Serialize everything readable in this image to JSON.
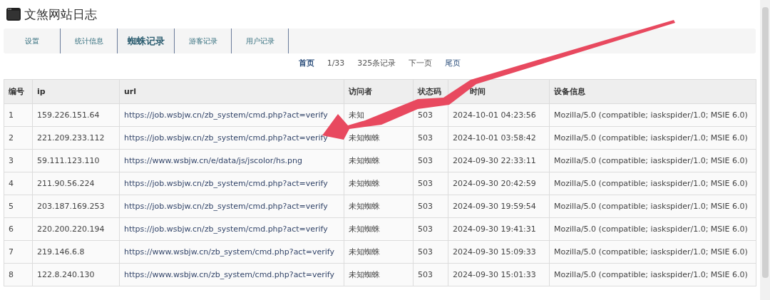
{
  "title": "文煞网站日志",
  "tabs": [
    {
      "label": "设置",
      "selected": false
    },
    {
      "label": "统计信息",
      "selected": false
    },
    {
      "label": "蜘蛛记录",
      "selected": true
    },
    {
      "label": "游客记录",
      "selected": false
    },
    {
      "label": "用户记录",
      "selected": false
    }
  ],
  "pager": [
    {
      "text": "首页",
      "kind": "link"
    },
    {
      "text": "1/33",
      "kind": "text"
    },
    {
      "text": "325条记录",
      "kind": "text"
    },
    {
      "text": "下一页",
      "kind": "text"
    },
    {
      "text": "尾页",
      "kind": "link"
    }
  ],
  "table": {
    "columns": [
      "编号",
      "ip",
      "url",
      "访问者",
      "状态码",
      "时间",
      "设备信息"
    ],
    "rows": [
      [
        "1",
        "159.226.151.64",
        "https://job.wsbjw.cn/zb_system/cmd.php?act=verify",
        "未知",
        "503",
        "2024-10-01 04:23:56",
        "Mozilla/5.0 (compatible; iaskspider/1.0; MSIE 6.0)"
      ],
      [
        "2",
        "221.209.233.112",
        "https://job.wsbjw.cn/zb_system/cmd.php?act=verify",
        "未知蜘蛛",
        "503",
        "2024-10-01 03:58:42",
        "Mozilla/5.0 (compatible; iaskspider/1.0; MSIE 6.0)"
      ],
      [
        "3",
        "59.111.123.110",
        "https://www.wsbjw.cn/e/data/js/jscolor/hs.png",
        "未知蜘蛛",
        "503",
        "2024-09-30 22:33:11",
        "Mozilla/5.0 (compatible; iaskspider/1.0; MSIE 6.0)"
      ],
      [
        "4",
        "211.90.56.224",
        "https://job.wsbjw.cn/zb_system/cmd.php?act=verify",
        "未知蜘蛛",
        "503",
        "2024-09-30 20:42:59",
        "Mozilla/5.0 (compatible; iaskspider/1.0; MSIE 6.0)"
      ],
      [
        "5",
        "203.187.169.253",
        "https://job.wsbjw.cn/zb_system/cmd.php?act=verify",
        "未知蜘蛛",
        "503",
        "2024-09-30 19:59:54",
        "Mozilla/5.0 (compatible; iaskspider/1.0; MSIE 6.0)"
      ],
      [
        "6",
        "220.200.220.194",
        "https://job.wsbjw.cn/zb_system/cmd.php?act=verify",
        "未知蜘蛛",
        "503",
        "2024-09-30 19:41:31",
        "Mozilla/5.0 (compatible; iaskspider/1.0; MSIE 6.0)"
      ],
      [
        "7",
        "219.146.6.8",
        "https://www.wsbjw.cn/zb_system/cmd.php?act=verify",
        "未知蜘蛛",
        "503",
        "2024-09-30 15:09:33",
        "Mozilla/5.0 (compatible; iaskspider/1.0; MSIE 6.0)"
      ],
      [
        "8",
        "122.8.240.130",
        "https://www.wsbjw.cn/zb_system/cmd.php?act=verify",
        "未知蜘蛛",
        "503",
        "2024-09-30 15:01:33",
        "Mozilla/5.0 (compatible; iaskspider/1.0; MSIE 6.0)"
      ]
    ]
  }
}
